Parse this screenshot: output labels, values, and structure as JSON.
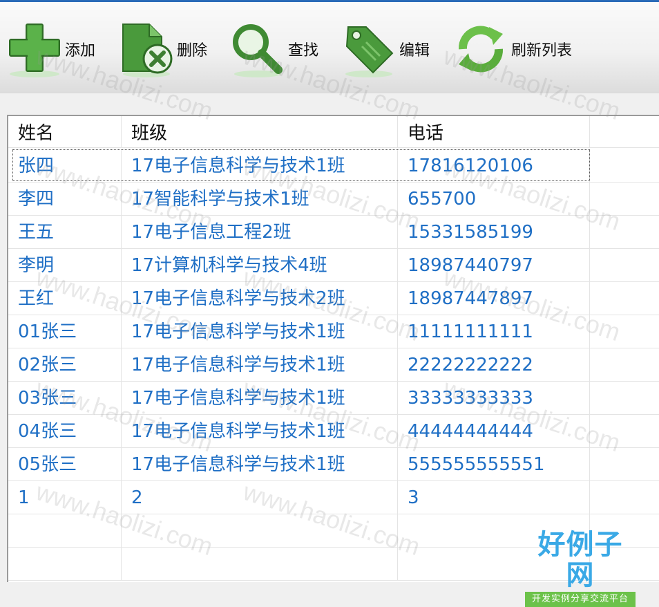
{
  "toolbar": {
    "add": {
      "label": "添加",
      "icon": "plus-icon"
    },
    "delete": {
      "label": "删除",
      "icon": "delete-document-icon"
    },
    "find": {
      "label": "查找",
      "icon": "magnifier-icon"
    },
    "edit": {
      "label": "编辑",
      "icon": "tag-icon"
    },
    "refresh": {
      "label": "刷新列表",
      "icon": "refresh-icon"
    }
  },
  "table": {
    "columns": [
      "姓名",
      "班级",
      "电话"
    ],
    "rows": [
      [
        "张四",
        "17电子信息科学与技术1班",
        "17816120106"
      ],
      [
        "李四",
        "17智能科学与技术1班",
        "655700"
      ],
      [
        "王五",
        "17电子信息工程2班",
        "15331585199"
      ],
      [
        "李明",
        "17计算机科学与技术4班",
        "18987440797"
      ],
      [
        "王红",
        "17电子信息科学与技术2班",
        "18987447897"
      ],
      [
        "01张三",
        "17电子信息科学与技术1班",
        "11111111111"
      ],
      [
        "02张三",
        "17电子信息科学与技术1班",
        "22222222222"
      ],
      [
        "03张三",
        "17电子信息科学与技术1班",
        "33333333333"
      ],
      [
        "04张三",
        "17电子信息科学与技术1班",
        "44444444444"
      ],
      [
        "05张三",
        "17电子信息科学与技术1班",
        "555555555551"
      ],
      [
        "1",
        "2",
        "3"
      ],
      [
        "",
        "",
        ""
      ],
      [
        "",
        "",
        ""
      ]
    ]
  },
  "watermark": {
    "text": "www.haolizi.com"
  },
  "logo": {
    "main": "好例子网",
    "sub": "开发实例分享交流平台"
  },
  "colors": {
    "cell_text": "#1f6fc5",
    "header_text": "#111111",
    "accent_green": "#4caf50",
    "top_border": "#2a6bb8"
  }
}
